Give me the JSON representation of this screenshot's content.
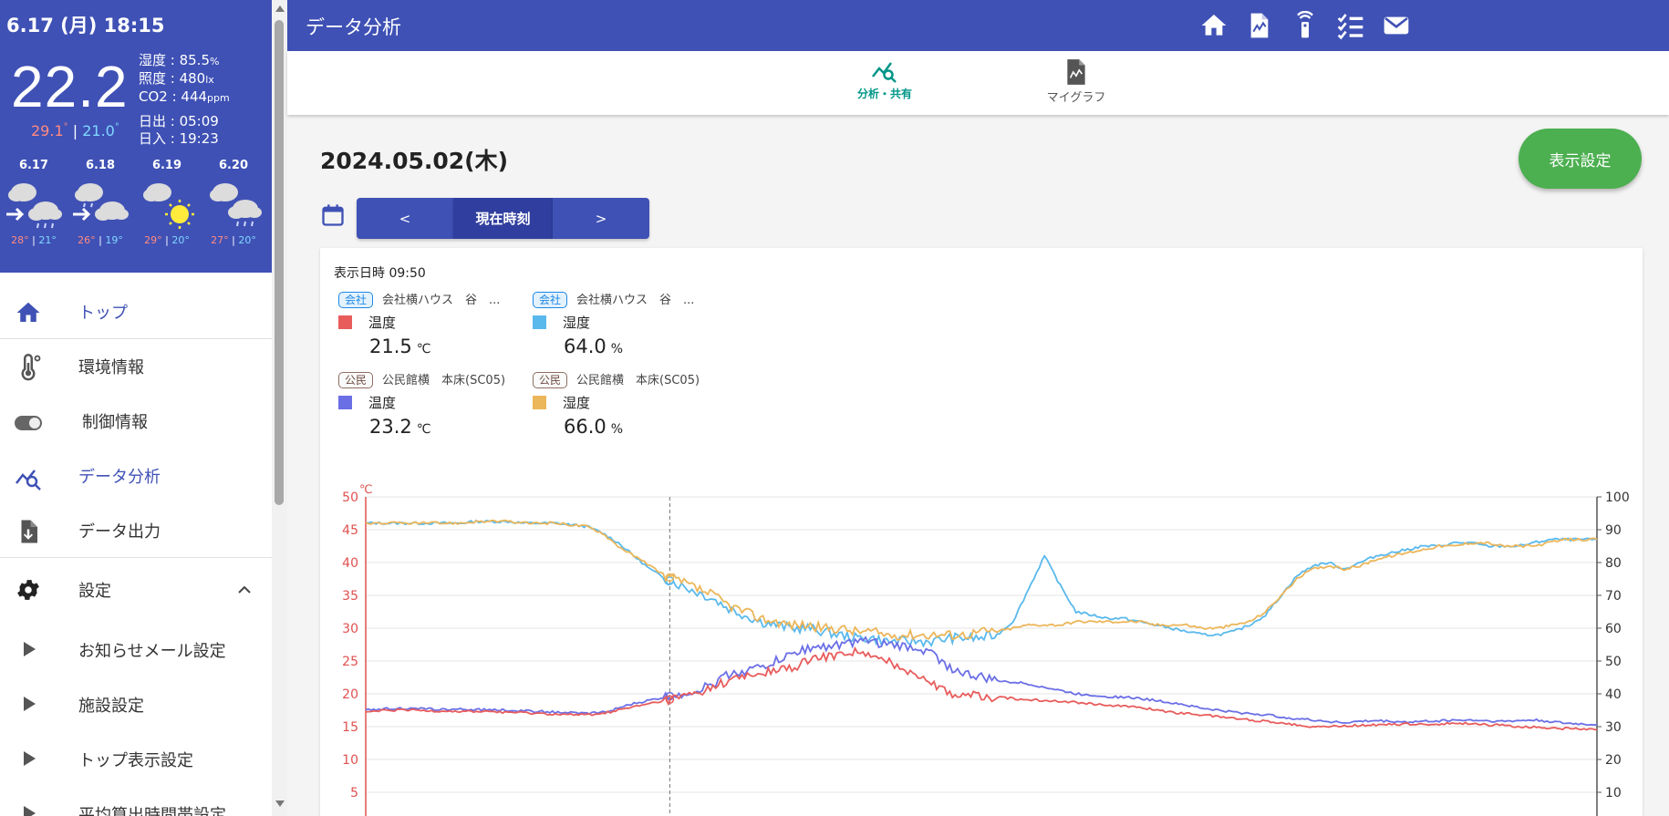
{
  "sidebar": {
    "weather": {
      "datetime": "6.17 (月) 18:15",
      "temp": "22.2",
      "high": "29.1",
      "low": "21.0",
      "humidity": "湿度 : 85.5",
      "humidity_unit": "%",
      "illuminance": "照度 : 480",
      "illuminance_unit": "lx",
      "co2": "CO2 : 444",
      "co2_unit": "ppm",
      "sunrise": "日出 : 05:09",
      "sunset": "日入 : 19:23",
      "forecast": [
        {
          "date": "6.17",
          "icon": "cloud-to-rain-icon",
          "high": "28",
          "low": "21"
        },
        {
          "date": "6.18",
          "icon": "cloud-to-rain-icon",
          "high": "26",
          "low": "19"
        },
        {
          "date": "6.19",
          "icon": "cloud-sun-icon",
          "high": "29",
          "low": "20"
        },
        {
          "date": "6.20",
          "icon": "cloud-rain-icon",
          "high": "27",
          "low": "20"
        }
      ]
    },
    "nav": [
      {
        "label": "トップ",
        "icon": "home-icon"
      },
      {
        "label": "環境情報",
        "icon": "thermometer-icon"
      },
      {
        "label": "制御情報",
        "icon": "toggle-icon"
      },
      {
        "label": "データ分析",
        "icon": "analytics-icon",
        "active": true
      },
      {
        "label": "データ出力",
        "icon": "download-file-icon"
      },
      {
        "label": "設定",
        "icon": "gear-icon"
      }
    ],
    "sub_nav": [
      {
        "label": "お知らせメール設定"
      },
      {
        "label": "施設設定"
      },
      {
        "label": "トップ表示設定"
      },
      {
        "label": "平均算出時間帯設定"
      }
    ]
  },
  "header": {
    "title": "データ分析",
    "icons": [
      "home-icon",
      "chart-file-icon",
      "remote-icon",
      "checklist-icon",
      "mail-icon"
    ]
  },
  "tabs": [
    {
      "label": "分析・共有",
      "icon": "analytics-icon",
      "active": true
    },
    {
      "label": "マイグラフ",
      "icon": "chart-file-icon"
    }
  ],
  "main": {
    "date": "2024.05.02(木)",
    "display_settings_label": "表示設定",
    "prev_label": "<",
    "now_label": "現在時刻",
    "next_label": ">",
    "display_time": "表示日時 09:50",
    "legends": [
      {
        "badge": "会社",
        "badge_type": "company",
        "location": "会社横ハウス　谷　...",
        "metric": "温度",
        "color": "#e85c5c",
        "value": "21.5",
        "unit": "℃"
      },
      {
        "badge": "会社",
        "badge_type": "company",
        "location": "会社横ハウス　谷　...",
        "metric": "湿度",
        "color": "#5ab9ec",
        "value": "64.0",
        "unit": "%"
      },
      {
        "badge": "公民",
        "badge_type": "public",
        "location": "公民館横　本床(SC05)",
        "metric": "温度",
        "color": "#6b6fe6",
        "value": "23.2",
        "unit": "℃"
      },
      {
        "badge": "公民",
        "badge_type": "public",
        "location": "公民館横　本床(SC05)",
        "metric": "湿度",
        "color": "#ecb65a",
        "value": "66.0",
        "unit": "%"
      }
    ]
  },
  "chart_data": {
    "type": "line",
    "left_axis": {
      "unit": "℃",
      "ticks": [
        "50",
        "45",
        "40",
        "35",
        "30",
        "25",
        "20",
        "15",
        "10",
        "5"
      ],
      "ylim": [
        0,
        50
      ],
      "color": "#e05050"
    },
    "right_axis": {
      "ticks": [
        "100",
        "90",
        "80",
        "70",
        "60",
        "50",
        "40",
        "30",
        "20",
        "10"
      ],
      "ylim": [
        0,
        100
      ]
    },
    "grid": true,
    "cursor_x": 0.247,
    "series": [
      {
        "color": "#5ab9ec",
        "axis": "right",
        "values": [
          92,
          92,
          92,
          92,
          92,
          92,
          92,
          92.5,
          92.5,
          92.5,
          92,
          92,
          92,
          91.5,
          91,
          89,
          86,
          82,
          78,
          75,
          73,
          71,
          69,
          66,
          64,
          62,
          61,
          60,
          60,
          59,
          58,
          57,
          57,
          56,
          56,
          56,
          56,
          57,
          57,
          57,
          58,
          62,
          72,
          82,
          73,
          65,
          64,
          63,
          63,
          62,
          61,
          60,
          59,
          58,
          58,
          59,
          61,
          64,
          70,
          76,
          79,
          80,
          78,
          80,
          82,
          83,
          84,
          85,
          85,
          86,
          86,
          85,
          85,
          85,
          86,
          87,
          87,
          87,
          87
        ]
      },
      {
        "color": "#ecb65a",
        "axis": "right",
        "values": [
          92,
          92,
          92,
          92,
          92,
          92,
          92,
          92.5,
          92.5,
          92.5,
          92,
          92,
          92,
          91.5,
          91,
          89,
          85,
          82,
          79,
          76,
          74,
          72,
          70,
          67,
          65,
          63,
          62,
          61,
          61,
          60,
          60,
          59,
          59,
          58,
          58,
          58,
          58,
          58,
          58,
          59,
          59,
          60,
          61,
          61,
          61,
          62,
          62,
          62,
          62,
          62,
          61,
          61,
          61,
          60,
          60,
          61,
          62,
          65,
          70,
          75,
          78,
          79,
          78,
          79,
          81,
          82,
          83,
          84,
          85,
          85,
          86,
          86,
          85,
          85,
          85,
          86,
          87,
          87,
          87
        ]
      },
      {
        "color": "#6b6fe6",
        "axis": "left",
        "values": [
          17.5,
          17.7,
          17.8,
          17.7,
          17.7,
          17.6,
          17.6,
          17.6,
          17.6,
          17.5,
          17.4,
          17.3,
          17.2,
          17.1,
          17,
          17.2,
          17.8,
          18.5,
          19,
          19.5,
          20,
          20.5,
          21.5,
          23,
          23.5,
          24,
          25,
          26,
          27,
          27.2,
          27.5,
          27.8,
          28,
          27.5,
          27.2,
          27,
          26,
          24,
          23,
          22.5,
          22,
          21.8,
          21.5,
          21,
          20.5,
          20,
          19.8,
          19.6,
          19.5,
          19.3,
          19,
          18.7,
          18.3,
          17.8,
          17.5,
          17.2,
          17,
          16.8,
          16.5,
          16.2,
          16,
          15.8,
          15.6,
          15.8,
          15.9,
          15.8,
          15.7,
          15.8,
          15.9,
          16,
          16,
          15.9,
          15.8,
          15.9,
          16,
          15.8,
          15.5,
          15.4,
          15.3
        ]
      },
      {
        "color": "#e85c5c",
        "axis": "left",
        "values": [
          17.2,
          17.4,
          17.5,
          17.5,
          17.4,
          17.4,
          17.3,
          17.3,
          17.3,
          17.2,
          17.1,
          17.0,
          16.9,
          16.8,
          16.8,
          17.0,
          17.5,
          18,
          18.5,
          19,
          19.5,
          20,
          21,
          22,
          22.5,
          23,
          23.5,
          24,
          25,
          25.5,
          26,
          26.5,
          25.5,
          25,
          24,
          23,
          21.5,
          20,
          19.8,
          19.6,
          19.5,
          19.3,
          19.1,
          19,
          18.9,
          18.7,
          18.5,
          18.3,
          18.1,
          17.9,
          17.6,
          17.2,
          17,
          16.8,
          16.5,
          16.3,
          16,
          15.8,
          15.6,
          15.3,
          15,
          15,
          15.1,
          15.2,
          15.3,
          15.3,
          15.4,
          15.3,
          15.4,
          15.5,
          15.5,
          15.3,
          15.2,
          15,
          14.9,
          14.8,
          14.7,
          14.6,
          14.5
        ]
      }
    ]
  }
}
